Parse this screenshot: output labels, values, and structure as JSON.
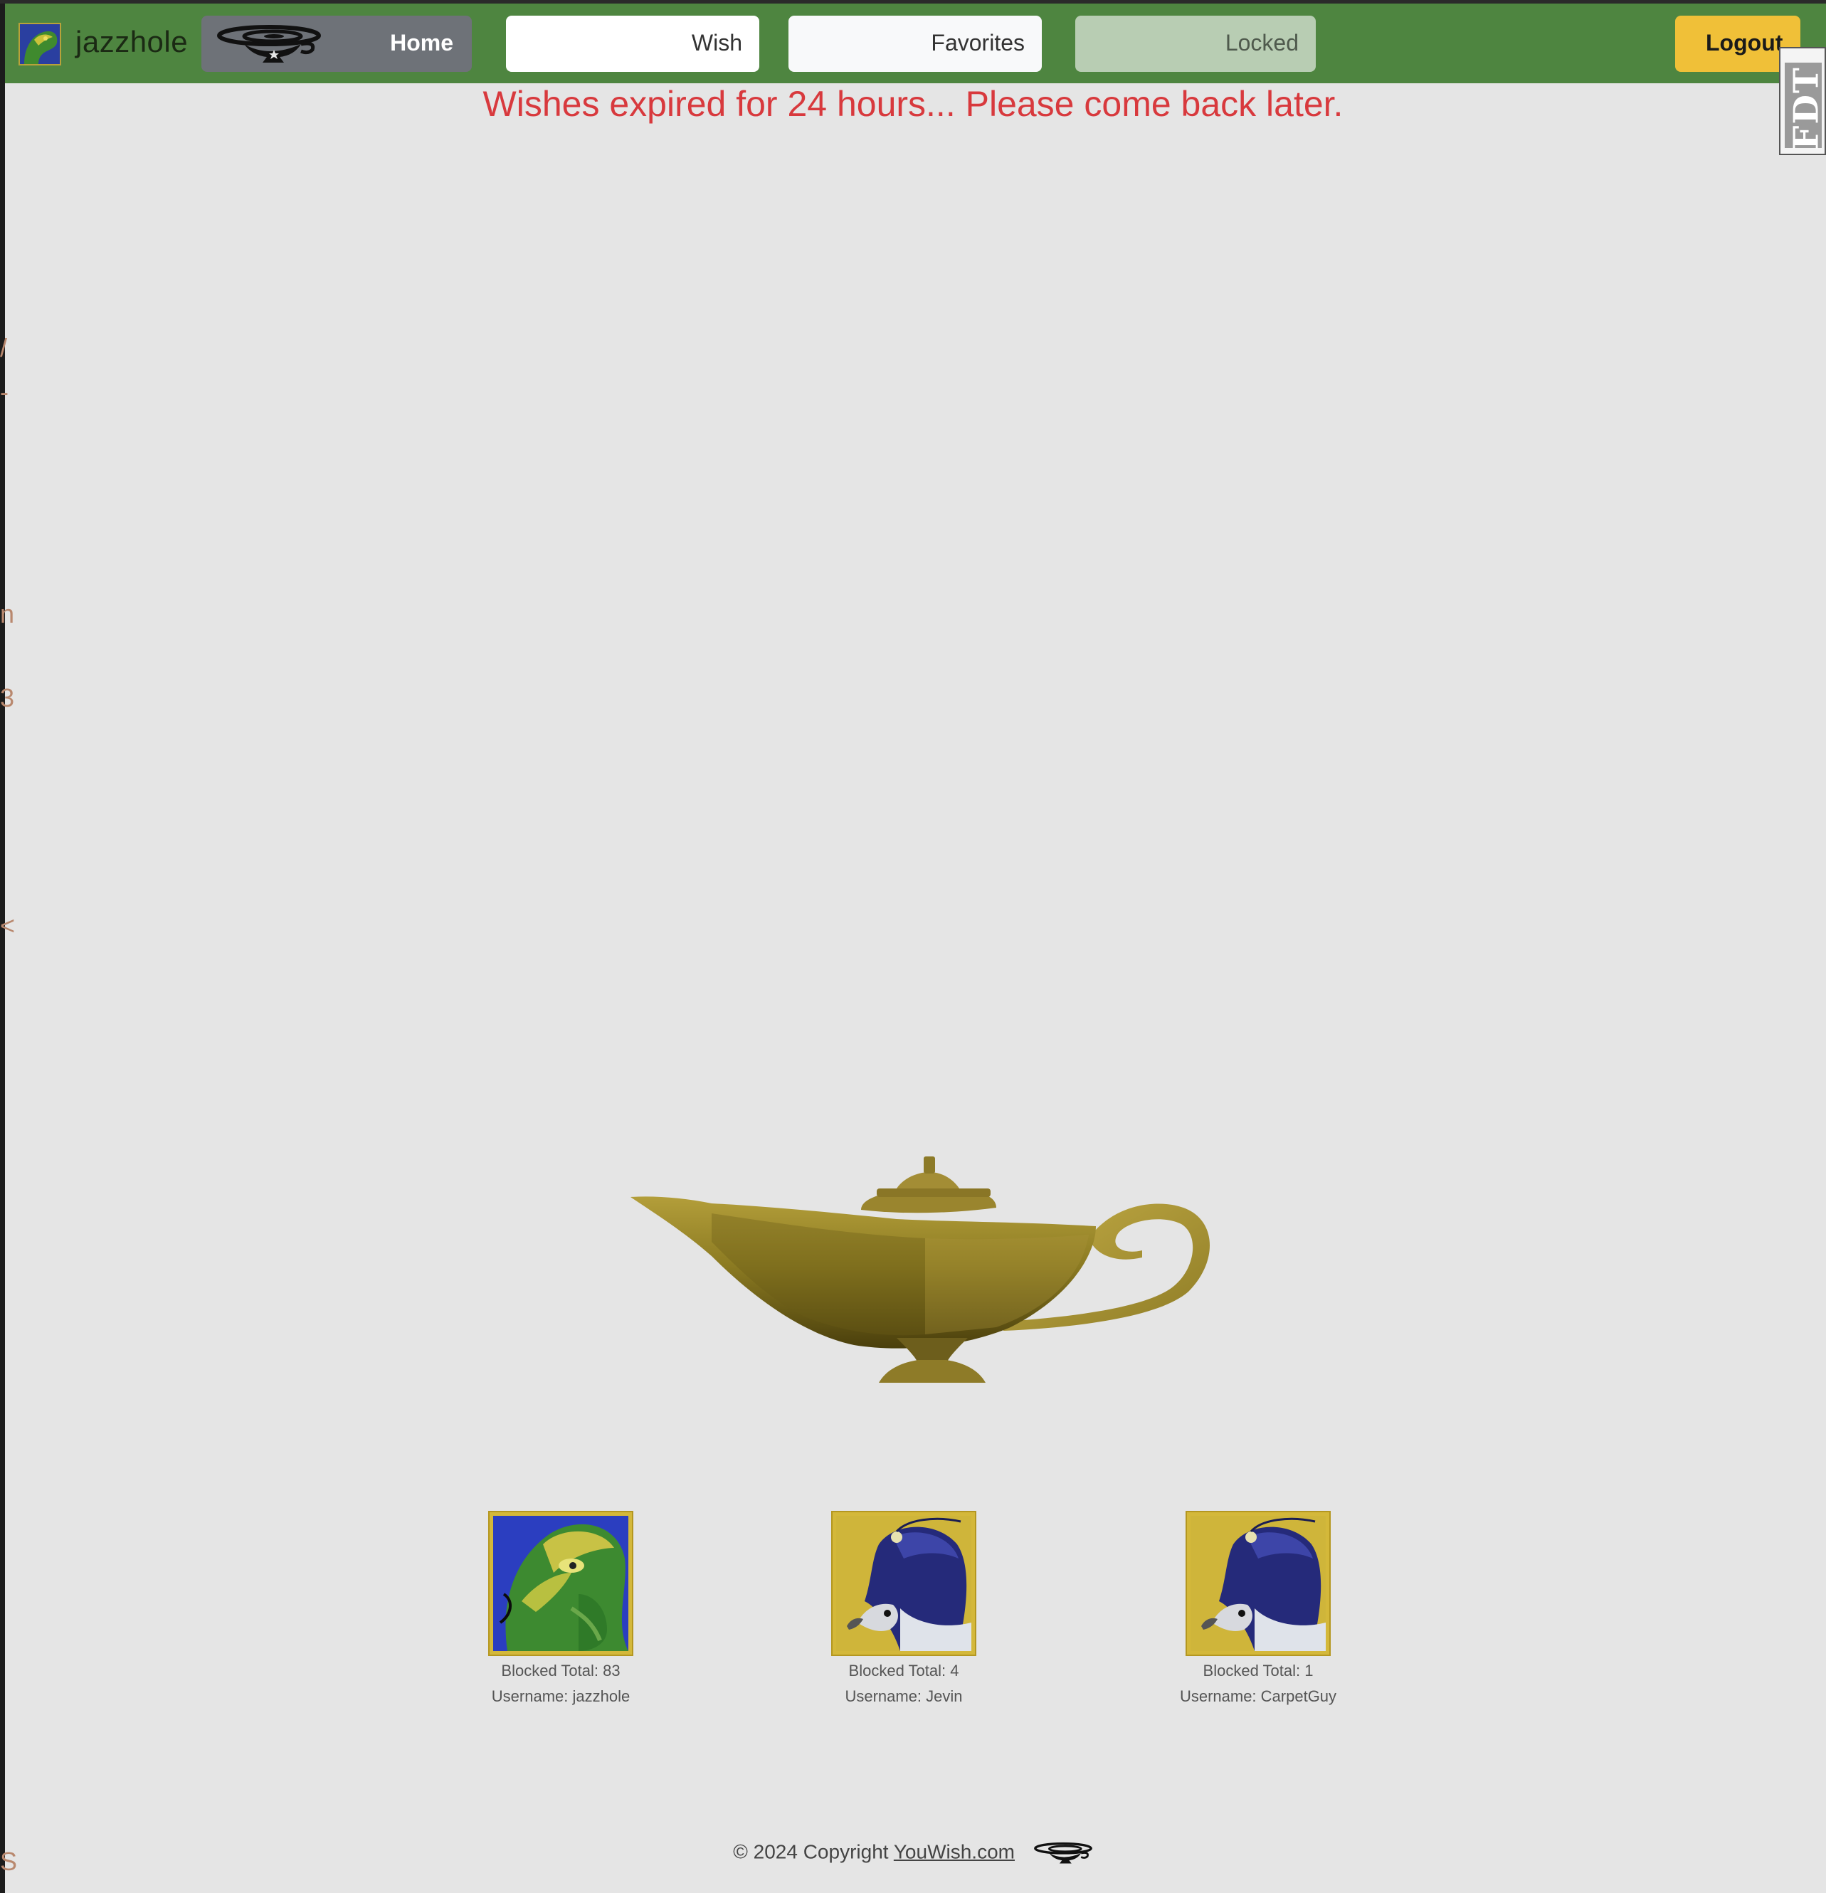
{
  "user": {
    "name": "jazzhole"
  },
  "nav": {
    "home_label": "Home",
    "wish_label": "Wish",
    "favorites_label": "Favorites",
    "locked_label": "Locked",
    "logout_label": "Logout"
  },
  "fdt_tab": {
    "label": "FDT"
  },
  "message": "Wishes expired for 24 hours... Please come back later.",
  "users": [
    {
      "blocked": "Blocked Total: 83",
      "username": "Username: jazzhole",
      "avatar": "cobra-icon"
    },
    {
      "blocked": "Blocked Total: 4",
      "username": "Username: Jevin",
      "avatar": "falcon-icon"
    },
    {
      "blocked": "Blocked Total: 1",
      "username": "Username: CarpetGuy",
      "avatar": "falcon-icon"
    }
  ],
  "footer": {
    "copyright": "© 2024 Copyright",
    "link": "YouWish.com"
  },
  "colors": {
    "navbar": "#4e8540",
    "message": "#d8393d",
    "logout": "#f0c038",
    "background": "#e5e5e5"
  }
}
